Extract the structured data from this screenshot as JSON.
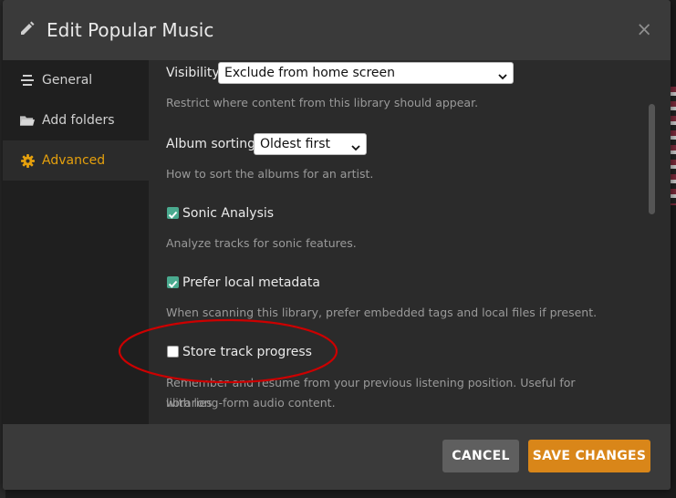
{
  "modal": {
    "title": "Edit Popular Music",
    "close_label": "×"
  },
  "sidebar": {
    "items": [
      {
        "label": "General",
        "icon": "list-icon",
        "active": false
      },
      {
        "label": "Add folders",
        "icon": "folder-icon",
        "active": false
      },
      {
        "label": "Advanced",
        "icon": "gear-icon",
        "active": true
      }
    ]
  },
  "settings": {
    "visibility": {
      "label": "Visibility",
      "selected": "Exclude from home screen",
      "help": "Restrict where content from this library should appear."
    },
    "album_sorting": {
      "label": "Album sorting",
      "selected": "Oldest first",
      "help": "How to sort the albums for an artist."
    },
    "sonic_analysis": {
      "label": "Sonic Analysis",
      "checked": true,
      "help": "Analyze tracks for sonic features."
    },
    "prefer_local_metadata": {
      "label": "Prefer local metadata",
      "checked": true,
      "help": "When scanning this library, prefer embedded tags and local files if present."
    },
    "store_track_progress": {
      "label": "Store track progress",
      "checked": false,
      "help_line1": "Remember and resume from your previous listening position. Useful for libraries",
      "help_line2": "with long-form audio content."
    }
  },
  "footer": {
    "cancel_label": "CANCEL",
    "save_label": "SAVE CHANGES"
  },
  "colors": {
    "accent": "#e5a00d",
    "save_button": "#d98619",
    "checkbox_checked": "#4aaa8f",
    "annotation": "#cc0000"
  }
}
